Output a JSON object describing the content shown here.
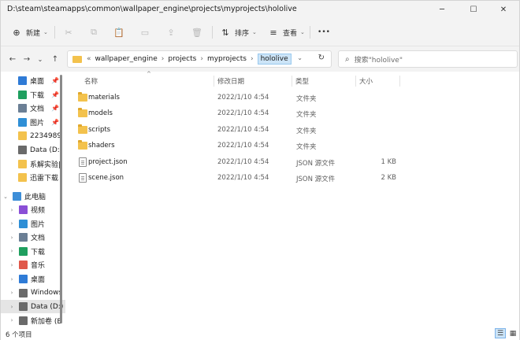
{
  "window": {
    "title": "D:\\steam\\steamapps\\common\\wallpaper_engine\\projects\\myprojects\\hololive",
    "minimize": "─",
    "maximize": "☐",
    "close": "✕"
  },
  "toolbar": {
    "new_icon": "⊕",
    "new_label": "新建",
    "new_caret": "⌄",
    "cut_icon": "✂",
    "copy_icon": "⧉",
    "paste_icon": "📋",
    "rename_icon": "▭",
    "share_icon": "⇪",
    "delete_icon": "🗑",
    "sort_icon": "⇅",
    "sort_label": "排序",
    "sort_caret": "⌄",
    "view_icon": "≡",
    "view_label": "查看",
    "view_caret": "⌄",
    "more_icon": "•••"
  },
  "nav": {
    "back": "←",
    "forward": "→",
    "recent": "⌄",
    "up": "↑",
    "breadcrumb_overflow": "«",
    "breadcrumb": [
      "wallpaper_engine",
      "projects",
      "myprojects",
      "hololive"
    ],
    "chevron": "›",
    "dropdown": "⌄",
    "refresh": "↻",
    "search_icon": "⌕",
    "search_placeholder": "搜索\"hololive\""
  },
  "sidebar": {
    "quick_access": [
      {
        "label": "桌面",
        "color": "#2f7bd6",
        "pin": "📌"
      },
      {
        "label": "下载",
        "color": "#1f9f5f",
        "pin": "📌"
      },
      {
        "label": "文档",
        "color": "#6b7f95",
        "pin": "📌"
      },
      {
        "label": "图片",
        "color": "#2f8fd6",
        "pin": "📌"
      },
      {
        "label": "2234989",
        "color": "#f3c24d",
        "pin": ""
      },
      {
        "label": "Data (D:",
        "color": "#6a6a6a",
        "pin": ""
      },
      {
        "label": "系解实验|",
        "color": "#f3c24d",
        "pin": ""
      },
      {
        "label": "迅雷下载",
        "color": "#f3c24d",
        "pin": ""
      }
    ],
    "this_pc": {
      "label": "此电脑",
      "expander": "⌄",
      "color": "#3d8ed8"
    },
    "pc_items": [
      {
        "label": "视频",
        "color": "#8a4fd6",
        "expander": "›",
        "selected": false
      },
      {
        "label": "图片",
        "color": "#2f8fd6",
        "expander": "›",
        "selected": false
      },
      {
        "label": "文档",
        "color": "#6b7f95",
        "expander": "›",
        "selected": false
      },
      {
        "label": "下载",
        "color": "#1f9f5f",
        "expander": "›",
        "selected": false
      },
      {
        "label": "音乐",
        "color": "#e0584a",
        "expander": "›",
        "selected": false
      },
      {
        "label": "桌面",
        "color": "#2f7bd6",
        "expander": "›",
        "selected": false
      },
      {
        "label": "Windows",
        "color": "#6a6a6a",
        "expander": "›",
        "selected": false
      },
      {
        "label": "Data (D:)",
        "color": "#6a6a6a",
        "expander": "›",
        "selected": true
      },
      {
        "label": "新加卷 (E",
        "color": "#6a6a6a",
        "expander": "›",
        "selected": false
      }
    ]
  },
  "columns": {
    "name": "名称",
    "date": "修改日期",
    "type": "类型",
    "size": "大小",
    "sort_indicator": "^"
  },
  "files": [
    {
      "name": "materials",
      "date": "2022/1/10 4:54",
      "type": "文件夹",
      "size": "",
      "kind": "folder"
    },
    {
      "name": "models",
      "date": "2022/1/10 4:54",
      "type": "文件夹",
      "size": "",
      "kind": "folder"
    },
    {
      "name": "scripts",
      "date": "2022/1/10 4:54",
      "type": "文件夹",
      "size": "",
      "kind": "folder"
    },
    {
      "name": "shaders",
      "date": "2022/1/10 4:54",
      "type": "文件夹",
      "size": "",
      "kind": "folder"
    },
    {
      "name": "project.json",
      "date": "2022/1/10 4:54",
      "type": "JSON 源文件",
      "size": "1 KB",
      "kind": "file"
    },
    {
      "name": "scene.json",
      "date": "2022/1/10 4:54",
      "type": "JSON 源文件",
      "size": "2 KB",
      "kind": "file"
    }
  ],
  "status": {
    "item_count": "6 个项目",
    "details_view_icon": "☰",
    "tiles_view_icon": "▦"
  }
}
